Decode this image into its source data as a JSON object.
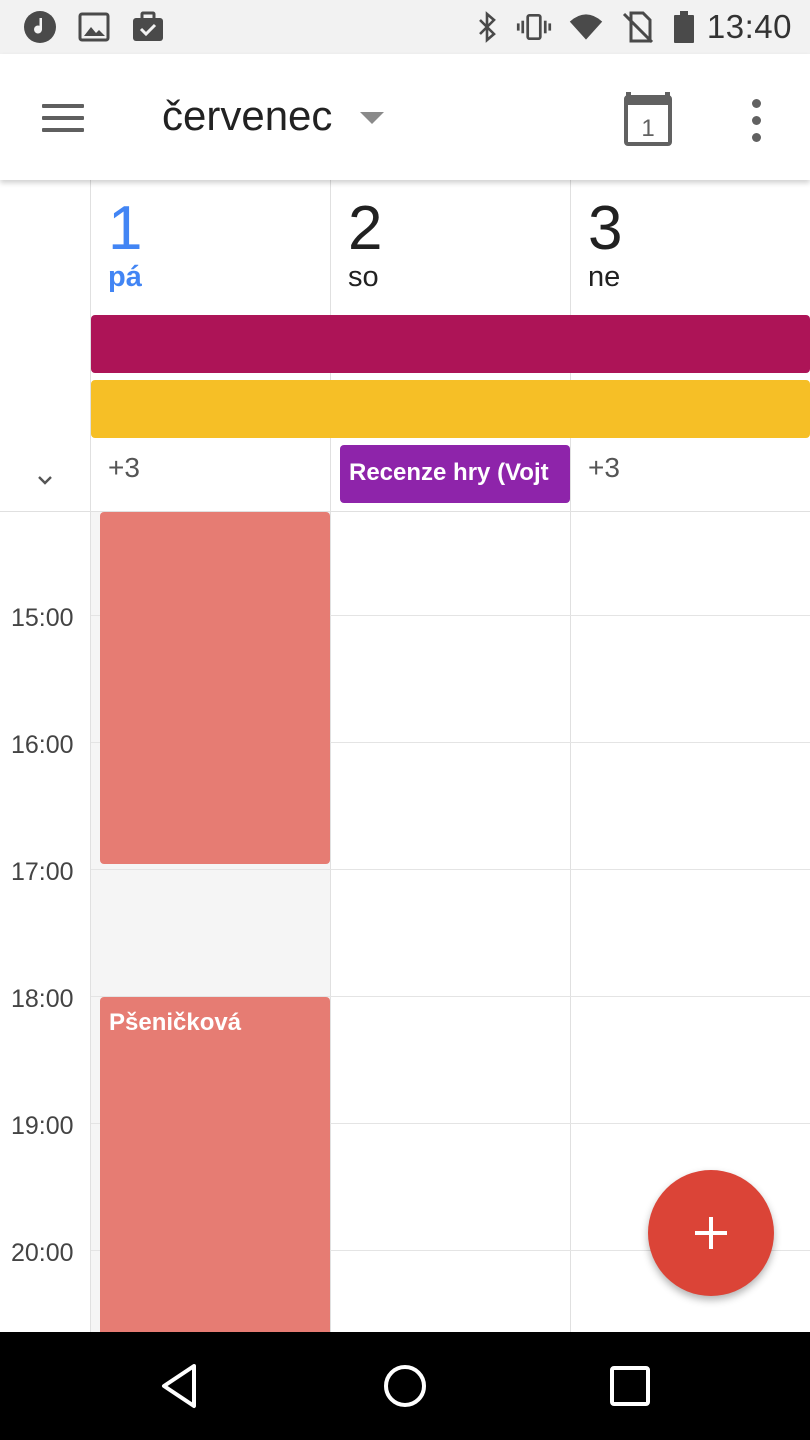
{
  "status_bar": {
    "time": "13:40",
    "left_icons": [
      "music-icon",
      "image-icon",
      "work-icon"
    ],
    "right_icons": [
      "bluetooth-icon",
      "vibrate-icon",
      "wifi-icon",
      "no-sim-icon",
      "battery-icon"
    ]
  },
  "app_bar": {
    "month": "červenec",
    "today_day": "1",
    "menu_icon": "hamburger-menu-icon",
    "more_icon": "more-vert-icon"
  },
  "days": [
    {
      "number": "1",
      "name": "pá",
      "is_today": true,
      "more": "+3"
    },
    {
      "number": "2",
      "name": "so",
      "is_today": false,
      "more": ""
    },
    {
      "number": "3",
      "name": "ne",
      "is_today": false,
      "more": "+3"
    }
  ],
  "all_day": {
    "bars": [
      {
        "color": "#ad1457"
      },
      {
        "color": "#f6bf26"
      }
    ],
    "event": {
      "title": "Recenze hry (Vojt",
      "color": "#8e24aa"
    }
  },
  "hours": [
    "15:00",
    "16:00",
    "17:00",
    "18:00",
    "19:00",
    "20:00"
  ],
  "events": [
    {
      "title": "",
      "day": "1",
      "start": "14:10",
      "end": "16:55",
      "color": "#e67c73"
    },
    {
      "title": "Pšeničková",
      "day": "1",
      "start": "17:45",
      "end": "20:40",
      "color": "#e67c73"
    }
  ],
  "fab": {
    "label": "+",
    "color": "#db4437"
  },
  "nav": {
    "back": "back-icon",
    "home": "home-icon",
    "recents": "recents-icon"
  }
}
